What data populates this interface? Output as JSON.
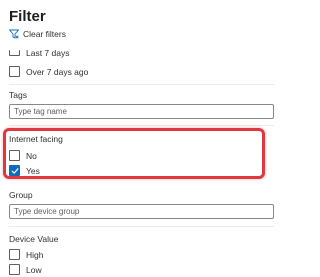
{
  "filter_panel": {
    "title": "Filter",
    "clear_filters_label": "Clear filters",
    "last_seen": {
      "options": [
        {
          "label": "Last 7 days",
          "checked": false
        },
        {
          "label": "Over 7 days ago",
          "checked": false
        }
      ]
    },
    "tags": {
      "label": "Tags",
      "placeholder": "Type tag name",
      "value": ""
    },
    "internet_facing": {
      "label": "Internet facing",
      "highlighted": true,
      "highlight_color": "#e0383f",
      "options": [
        {
          "label": "No",
          "checked": false
        },
        {
          "label": "Yes",
          "checked": true
        }
      ]
    },
    "group": {
      "label": "Group",
      "placeholder": "Type device group",
      "value": ""
    },
    "device_value": {
      "label": "Device Value",
      "options": [
        {
          "label": "High",
          "checked": false
        },
        {
          "label": "Low",
          "checked": false
        }
      ]
    }
  },
  "colors": {
    "accent": "#0f6cbd",
    "text": "#323130",
    "border": "#8a8886"
  },
  "icons": {
    "clear_filters": "filter-clear-icon",
    "checkmark": "checkmark-icon"
  }
}
